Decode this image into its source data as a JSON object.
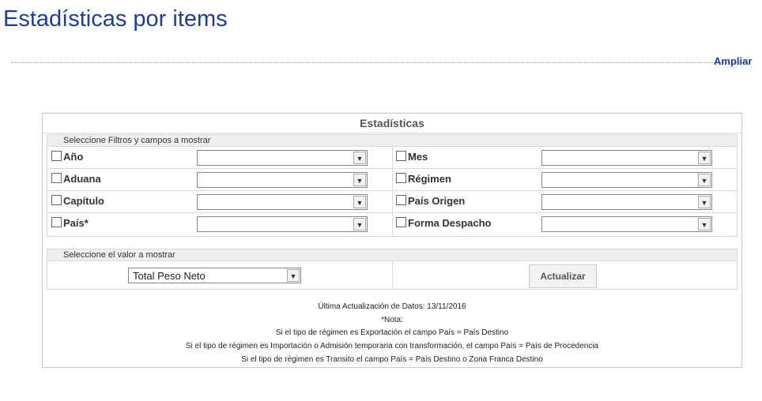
{
  "header": {
    "title": "Estadísticas por items",
    "expand_link": "Ampliar"
  },
  "panel": {
    "title": "Estadísticas",
    "filters_section": {
      "header": "Seleccione Filtros y campos a mostrar",
      "left": [
        {
          "label": "Año",
          "checked": false,
          "value": ""
        },
        {
          "label": "Aduana",
          "checked": false,
          "value": ""
        },
        {
          "label": "Capítulo",
          "checked": false,
          "value": ""
        },
        {
          "label": "País*",
          "checked": false,
          "value": ""
        }
      ],
      "right": [
        {
          "label": "Mes",
          "checked": false,
          "value": ""
        },
        {
          "label": "Régimen",
          "checked": false,
          "value": ""
        },
        {
          "label": "País Origen",
          "checked": false,
          "value": ""
        },
        {
          "label": "Forma Despacho",
          "checked": false,
          "value": ""
        }
      ]
    },
    "value_section": {
      "header": "Seleccione el valor a mostrar",
      "selected_value": "Total Peso Neto",
      "update_button": "Actualizar"
    },
    "info": {
      "last_update": "Última Actualización de Datos: 13/11/2016",
      "note_title": "*Nota:",
      "notes": [
        "Si el tipo de régimen es Exportación el campo País = País Destino",
        "Si el tipo de régimen es Importación o Admisión temporaria con transformación, el campo País = País de Procedencia",
        "Si el tipo de régimen es Transito el campo País = País Destino o Zona Franca Destino"
      ]
    }
  }
}
